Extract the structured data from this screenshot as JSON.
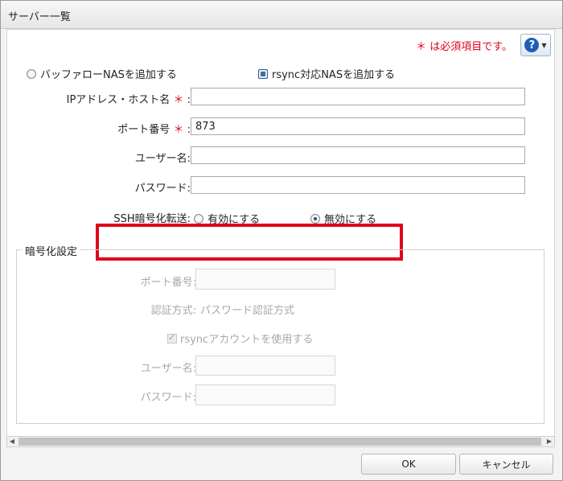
{
  "window": {
    "title": "サーバー一覧"
  },
  "header": {
    "required_note": "＊ は必須項目です。",
    "help_icon_glyph": "?"
  },
  "mode": {
    "buffalo_label": "バッファローNASを追加する",
    "rsync_label": "rsync対応NASを追加する",
    "selected": "rsync"
  },
  "fields": {
    "host_label": "IPアドレス・ホスト名",
    "port_label": "ポート番号",
    "port_value": "873",
    "user_label": "ユーザー名:",
    "password_label": "パスワード:",
    "required_mark": "＊",
    "colon": ":"
  },
  "ssh": {
    "label": "SSH暗号化転送:",
    "enable_label": "有効にする",
    "disable_label": "無効にする",
    "selected": "disable"
  },
  "encryption": {
    "legend": "暗号化設定",
    "port_label": "ポート番号:",
    "auth_label": "認証方式:",
    "auth_value": "パスワード認証方式",
    "rsync_account_label": "rsyncアカウントを使用する",
    "user_label": "ユーザー名:",
    "password_label": "パスワード:"
  },
  "footer": {
    "ok_label": "OK",
    "cancel_label": "キャンセル"
  },
  "colors": {
    "accent_red": "#e0001a",
    "help_blue": "#1d5fb8"
  }
}
